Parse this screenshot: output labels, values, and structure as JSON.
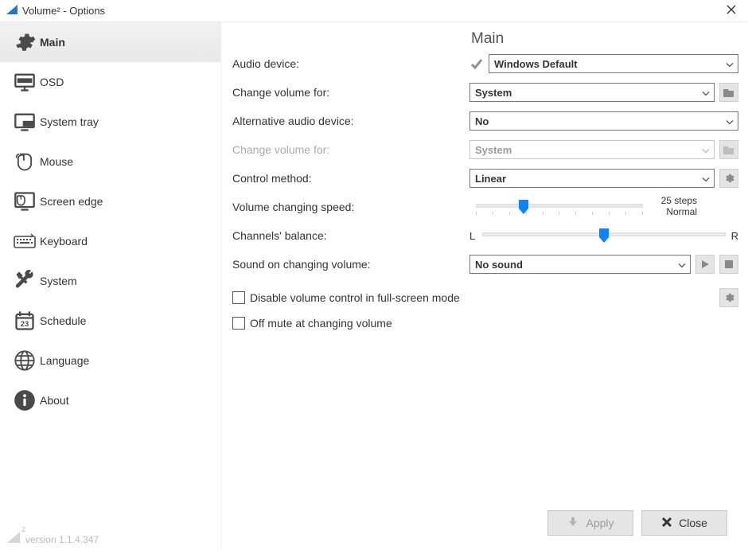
{
  "window": {
    "title": "Volume² - Options"
  },
  "sidebar": {
    "items": [
      {
        "label": "Main",
        "icon": "gear-icon"
      },
      {
        "label": "OSD",
        "icon": "monitor-icon"
      },
      {
        "label": "System tray",
        "icon": "tray-icon"
      },
      {
        "label": "Mouse",
        "icon": "mouse-icon"
      },
      {
        "label": "Screen edge",
        "icon": "screenedge-icon"
      },
      {
        "label": "Keyboard",
        "icon": "keyboard-icon"
      },
      {
        "label": "System",
        "icon": "tools-icon"
      },
      {
        "label": "Schedule",
        "icon": "calendar-icon"
      },
      {
        "label": "Language",
        "icon": "globe-icon"
      },
      {
        "label": "About",
        "icon": "info-icon"
      }
    ],
    "selected_index": 0,
    "version": "version 1.1.4.347",
    "logo_exponent": "2"
  },
  "main": {
    "heading": "Main",
    "labels": {
      "audio_device": "Audio device:",
      "change_volume_for": "Change volume for:",
      "alt_audio_device": "Alternative audio device:",
      "change_volume_for_alt": "Change volume for:",
      "control_method": "Control method:",
      "volume_speed": "Volume changing speed:",
      "channels_balance": "Channels' balance:",
      "sound_on_change": "Sound on changing volume:",
      "disable_fullscreen": "Disable volume control in full-screen mode",
      "off_mute": "Off mute at changing volume",
      "balance_left": "L",
      "balance_right": "R"
    },
    "values": {
      "audio_device": "Windows Default",
      "change_volume_for": "System",
      "alt_audio_device": "No",
      "change_volume_for_alt": "System",
      "control_method": "Linear",
      "sound_on_change": "No sound",
      "speed_steps": "25 steps",
      "speed_mode": "Normal",
      "speed_slider_pct": 25,
      "balance_slider_pct": 50,
      "disable_fullscreen_checked": false,
      "off_mute_checked": false
    }
  },
  "footer": {
    "apply": "Apply",
    "close": "Close"
  }
}
